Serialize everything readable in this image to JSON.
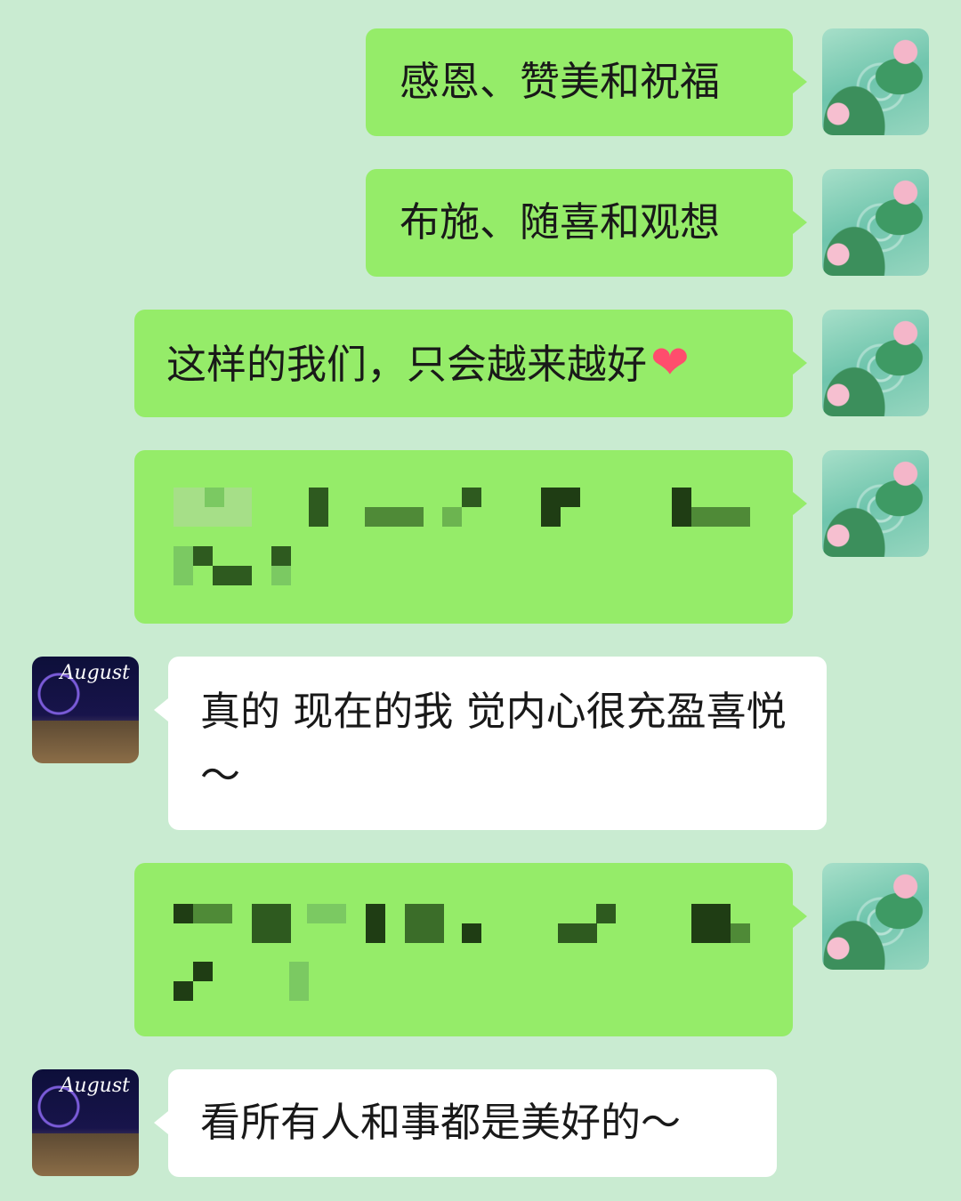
{
  "messages": [
    {
      "side": "me",
      "text": "感恩、赞美和祝福"
    },
    {
      "side": "me",
      "text": "布施、随喜和观想"
    },
    {
      "side": "me",
      "text": "这样的我们，只会越来越好",
      "emoji": "❤"
    },
    {
      "side": "me",
      "pixelated": true
    },
    {
      "side": "them",
      "text": "真的 现在的我 觉内心很充盈喜悦～"
    },
    {
      "side": "me",
      "pixelated": true
    },
    {
      "side": "them",
      "text": "看所有人和事都是美好的～"
    }
  ],
  "contact": {
    "avatar_text": "August"
  },
  "colors": {
    "background": "#c9ebd1",
    "my_bubble": "#95ec69",
    "their_bubble": "#ffffff",
    "heart": "#ff4d6d"
  }
}
